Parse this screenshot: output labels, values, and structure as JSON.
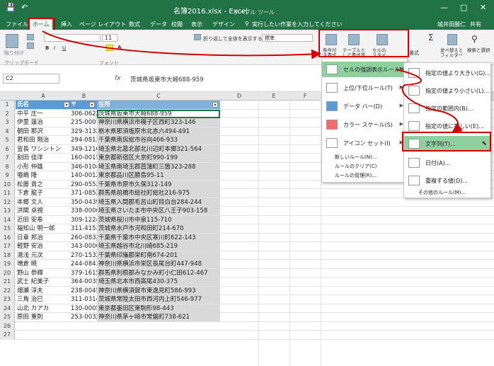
{
  "titlebar": {
    "title": "名簿2016.xlsx - Excel",
    "context": "テーブル ツール",
    "min": "—",
    "restore": "□",
    "close": "✕"
  },
  "tabs": [
    {
      "label": "ファイル"
    },
    {
      "label": "ホーム"
    },
    {
      "label": "挿入"
    },
    {
      "label": "ページ レイアウト"
    },
    {
      "label": "数式"
    },
    {
      "label": "データ"
    },
    {
      "label": "校閲"
    },
    {
      "label": "表示"
    },
    {
      "label": "デザイン"
    }
  ],
  "tellme": "実行したい作業を入力してください",
  "user": "城井田勝仁",
  "share": "共有",
  "ribbon": {
    "paste": "貼り付け",
    "clipboard": "クリップボード",
    "font_group": "フォント",
    "font_size": "11",
    "wrap": "折り返して全体を表示する",
    "number_format": "標準",
    "cond_format": "条件付き書式",
    "table_format": "テーブルとして書式設定",
    "cell_styles": "セルのスタイル",
    "format": "書式",
    "sort": "並べ替えとフィルター",
    "find": "検索と選択"
  },
  "formula": {
    "namebox": "C2",
    "fx": "fx",
    "value": "茨城県坂東市大崎688-959"
  },
  "columns": [
    "A",
    "B",
    "C",
    "D",
    "E",
    "F",
    "G",
    "H"
  ],
  "table_header": {
    "name": "氏名",
    "zip": "〒",
    "address": "住所"
  },
  "rows": [
    {
      "n": "2",
      "name": "中平 庄一",
      "zip": "306-0622",
      "address": "茨城県坂東市大崎688-959"
    },
    {
      "n": "3",
      "name": "伊里 蓮治",
      "zip": "235-0007",
      "address": "神奈川県横浜市磯子区西町323-146"
    },
    {
      "n": "4",
      "name": "朝田 那沢",
      "zip": "329-3132",
      "address": "栃木県那須塩原市北赤六494-491"
    },
    {
      "n": "5",
      "name": "君和田 剛治",
      "zip": "294-0813",
      "address": "千葉県南房総市谷向466-933"
    },
    {
      "n": "6",
      "name": "宣長 ワシントン",
      "zip": "349-1216",
      "address": "埼玉県北葛北部北川辺町本郷321-564"
    },
    {
      "n": "7",
      "name": "割田 佳洋",
      "zip": "160-0015",
      "address": "東京都新宿区大京町990-199"
    },
    {
      "n": "8",
      "name": "小形 仲雄",
      "zip": "346-0104",
      "address": "埼玉県南埼玉郡菖蒲町三箇323-288"
    },
    {
      "n": "9",
      "name": "唖嶋 隆",
      "zip": "140-0012",
      "address": "東京都品川区勝島95-11"
    },
    {
      "n": "10",
      "name": "松藤 貴之",
      "zip": "290-0552",
      "address": "千葉県市原市久保312-149"
    },
    {
      "n": "11",
      "name": "下倉 龍子",
      "zip": "371-0852",
      "address": "群馬県前橋市総社町総社216-975"
    },
    {
      "n": "12",
      "name": "本郷 文人",
      "zip": "350-0439",
      "address": "埼玉県入間郡毛呂山町目白台284-244"
    },
    {
      "n": "13",
      "name": "洪関 卓視",
      "zip": "338-0006",
      "address": "埼玉県さいたま市中央区八王子903-158"
    },
    {
      "n": "14",
      "name": "近田 安奉",
      "zip": "309-1224",
      "address": "茨城県桜川市中泉115-710"
    },
    {
      "n": "15",
      "name": "福知山 明一郎",
      "zip": "311-4153",
      "address": "茨城県水戸市河和田町214-670"
    },
    {
      "n": "16",
      "name": "日章 邦治",
      "zip": "260-0832",
      "address": "千葉県千葉市中央区寒川町622-143"
    },
    {
      "n": "17",
      "name": "軽野 安治",
      "zip": "343-0006",
      "address": "埼玉県越谷市北川崎685-219"
    },
    {
      "n": "18",
      "name": "湯浅 元次",
      "zip": "270-1532",
      "address": "千葉県印旛郡栄町南674-201"
    },
    {
      "n": "19",
      "name": "増倉 暁",
      "zip": "244-0843",
      "address": "神奈川県横浜市栄区長尾台町447-948"
    },
    {
      "n": "20",
      "name": "野山 恭輝",
      "zip": "379-1615",
      "address": "群馬県利根郡みなかみ町小仁田612-467"
    },
    {
      "n": "21",
      "name": "武士 紀美子",
      "zip": "364-0035",
      "address": "埼玉県北本市西高尾430-375"
    },
    {
      "n": "22",
      "name": "畑瀬 淳夫",
      "zip": "238-0045",
      "address": "神奈川県横須賀市東逸見町586-993"
    },
    {
      "n": "23",
      "name": "三角 治巳",
      "zip": "311-0314",
      "address": "茨城県常陸太田市西河内上町546-977"
    },
    {
      "n": "24",
      "name": "山北 カアカ",
      "zip": "130-0005",
      "address": "東京都墨田区東駒形98-443"
    },
    {
      "n": "25",
      "name": "原田 重則",
      "zip": "253-0032",
      "address": "神奈川県茅ヶ崎市常盤町738-621"
    }
  ],
  "empty_rows": [
    "26",
    "27"
  ],
  "menu1": {
    "items": [
      {
        "label": "セルの強調表示ルール(H)"
      },
      {
        "label": "上位/下位ルール(T)"
      },
      {
        "label": "データ バー(D)"
      },
      {
        "label": "カラー スケール(S)"
      },
      {
        "label": "アイコン セット(I)"
      }
    ],
    "small": [
      {
        "label": "新しいルール(N)..."
      },
      {
        "label": "ルールのクリア(C)"
      },
      {
        "label": "ルールの管理(R)..."
      }
    ]
  },
  "menu2": {
    "items": [
      {
        "label": "指定の値より大きい(G)..."
      },
      {
        "label": "指定の値より小さい(L)..."
      },
      {
        "label": "指定の範囲内(B)..."
      },
      {
        "label": "指定の値に等しい(E)..."
      },
      {
        "label": "文字列(T)..."
      },
      {
        "label": "日付(A)..."
      },
      {
        "label": "重複する値(D)..."
      }
    ],
    "more": "その他のルール(M)..."
  },
  "colors": {
    "excel_green": "#217346",
    "highlight_red": "#d00000",
    "table_header": "#5b9bd5",
    "menu_highlight": "#8fd19e"
  }
}
